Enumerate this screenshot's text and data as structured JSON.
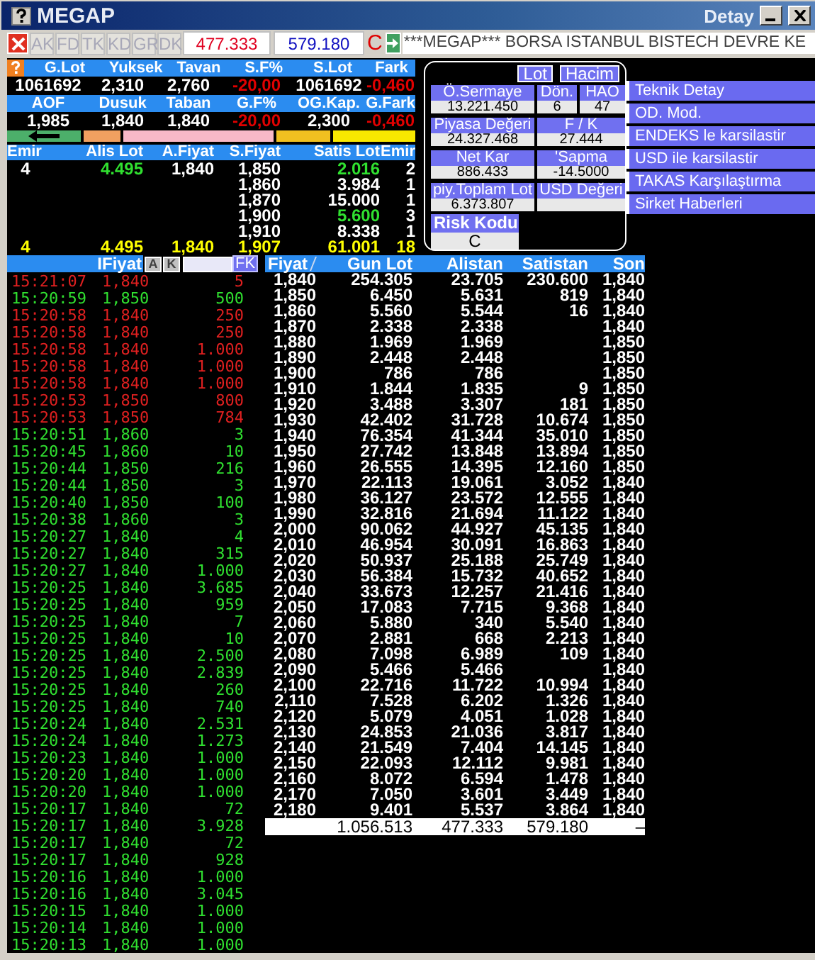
{
  "window": {
    "title": "MEGAP",
    "subtitle": "Detay"
  },
  "toolbar": {
    "buttons": [
      {
        "label": "AK"
      },
      {
        "label": "FD"
      },
      {
        "label": "TK"
      },
      {
        "label": "KD"
      },
      {
        "label": "GR"
      },
      {
        "label": "DK"
      }
    ],
    "buy_total": "477.333",
    "sell_total": "579.180",
    "risk_letter": "C",
    "ticker": "***MEGAP*** BORSA ISTANBUL BISTECH DEVRE KE"
  },
  "summary": [
    {
      "headers": [
        "G.Lot",
        "Yuksek",
        "Tavan",
        "S.F%",
        "S.Lot",
        "Fark"
      ],
      "values": [
        {
          "text": "1061692",
          "down": false
        },
        {
          "text": "2,310",
          "down": false
        },
        {
          "text": "2,760",
          "down": false
        },
        {
          "text": "-20,00",
          "down": true
        },
        {
          "text": "1061692",
          "down": false
        },
        {
          "text": "-0,460",
          "down": true
        }
      ]
    },
    {
      "headers": [
        "AOF",
        "Dusuk",
        "Taban",
        "G.F%",
        "OG.Kap.",
        "G.Fark"
      ],
      "values": [
        {
          "text": "1,985",
          "down": false
        },
        {
          "text": "1,840",
          "down": false
        },
        {
          "text": "1,840",
          "down": false
        },
        {
          "text": "-20,00",
          "down": true
        },
        {
          "text": "2,300",
          "down": false
        },
        {
          "text": "-0,460",
          "down": true
        }
      ]
    }
  ],
  "trend_bar": [
    {
      "color": "#4caf6a",
      "arrow": true
    },
    {
      "color": "#f0a060",
      "arrow": false
    },
    {
      "color": "#f8b8c8",
      "arrow": false
    },
    {
      "color": "#f0c020",
      "arrow": false
    },
    {
      "color": "#f8e800",
      "arrow": false
    }
  ],
  "depth": {
    "columns": [
      "Emir",
      "Alis Lot",
      "A.Fiyat",
      "S.Fiyat",
      "Satis Lot",
      "Emir"
    ],
    "rows": [
      {
        "kind": "level",
        "buy_orders": "4",
        "buy_lot": "4.495",
        "buy_lot_up": true,
        "buy_price": "1,840",
        "sell_price": "1,850",
        "sell_lot": "2.016",
        "sell_lot_up": true,
        "sell_orders": "2"
      },
      {
        "kind": "level",
        "sell_price": "1,860",
        "sell_lot": "3.984",
        "sell_lot_up": false,
        "sell_orders": "1"
      },
      {
        "kind": "level",
        "sell_price": "1,870",
        "sell_lot": "15.000",
        "sell_lot_up": false,
        "sell_orders": "1"
      },
      {
        "kind": "level",
        "sell_price": "1,900",
        "sell_lot": "5.600",
        "sell_lot_up": true,
        "sell_orders": "3"
      },
      {
        "kind": "level",
        "sell_price": "1,910",
        "sell_lot": "8.338",
        "sell_lot_up": false,
        "sell_orders": "1"
      },
      {
        "kind": "total",
        "buy_orders": "4",
        "buy_lot": "4.495",
        "buy_price": "1,840",
        "sell_price": "1,907",
        "sell_lot": "61.001",
        "sell_orders": "18"
      }
    ]
  },
  "info": {
    "tabs": [
      {
        "label": "Lot"
      },
      {
        "label": "Hacim"
      }
    ],
    "fields": [
      {
        "label": "Ö.Sermaye",
        "value": "13.221.450"
      },
      {
        "label": "Dön.",
        "value": "6"
      },
      {
        "label": "HAO",
        "value": "47"
      },
      {
        "label": "Piyasa Değeri",
        "value": "24.327.468"
      },
      {
        "label": "F / K",
        "value": "27.444"
      },
      {
        "label": "Net Kar",
        "value": "886.433"
      },
      {
        "label": "'Sapma",
        "value": "-14.5000"
      },
      {
        "label": "piy.Toplam Lot",
        "value": "6.373.807"
      },
      {
        "label": "USD Değeri"
      }
    ],
    "risk": {
      "label": "Risk Kodu",
      "value": "C"
    }
  },
  "links": [
    "Teknik Detay",
    "OD. Mod.",
    "ENDEKS le karsilastir",
    "USD ile karsilastir",
    "TAKAS Karşılaştırma",
    "Sirket Haberleri"
  ],
  "trades": {
    "header": "IFiyat",
    "buttons": [
      "A",
      "K"
    ],
    "filter_button": "FK",
    "rows": [
      {
        "time": "15:21:07",
        "price": "1,840",
        "lot": "5",
        "down": true
      },
      {
        "time": "15:20:59",
        "price": "1,850",
        "lot": "500",
        "down": false
      },
      {
        "time": "15:20:58",
        "price": "1,840",
        "lot": "250",
        "down": true
      },
      {
        "time": "15:20:58",
        "price": "1,840",
        "lot": "250",
        "down": true
      },
      {
        "time": "15:20:58",
        "price": "1,840",
        "lot": "1.000",
        "down": true
      },
      {
        "time": "15:20:58",
        "price": "1,840",
        "lot": "1.000",
        "down": true
      },
      {
        "time": "15:20:58",
        "price": "1,840",
        "lot": "1.000",
        "down": true
      },
      {
        "time": "15:20:53",
        "price": "1,850",
        "lot": "800",
        "down": true
      },
      {
        "time": "15:20:53",
        "price": "1,850",
        "lot": "784",
        "down": true
      },
      {
        "time": "15:20:51",
        "price": "1,860",
        "lot": "3",
        "down": false
      },
      {
        "time": "15:20:45",
        "price": "1,860",
        "lot": "10",
        "down": false
      },
      {
        "time": "15:20:44",
        "price": "1,850",
        "lot": "216",
        "down": false
      },
      {
        "time": "15:20:44",
        "price": "1,850",
        "lot": "3",
        "down": false
      },
      {
        "time": "15:20:40",
        "price": "1,850",
        "lot": "100",
        "down": false
      },
      {
        "time": "15:20:38",
        "price": "1,860",
        "lot": "3",
        "down": false
      },
      {
        "time": "15:20:27",
        "price": "1,840",
        "lot": "4",
        "down": false
      },
      {
        "time": "15:20:27",
        "price": "1,840",
        "lot": "315",
        "down": false
      },
      {
        "time": "15:20:27",
        "price": "1,840",
        "lot": "1.000",
        "down": false
      },
      {
        "time": "15:20:25",
        "price": "1,840",
        "lot": "3.685",
        "down": false
      },
      {
        "time": "15:20:25",
        "price": "1,840",
        "lot": "959",
        "down": false
      },
      {
        "time": "15:20:25",
        "price": "1,840",
        "lot": "7",
        "down": false
      },
      {
        "time": "15:20:25",
        "price": "1,840",
        "lot": "10",
        "down": false
      },
      {
        "time": "15:20:25",
        "price": "1,840",
        "lot": "2.500",
        "down": false
      },
      {
        "time": "15:20:25",
        "price": "1,840",
        "lot": "2.839",
        "down": false
      },
      {
        "time": "15:20:25",
        "price": "1,840",
        "lot": "260",
        "down": false
      },
      {
        "time": "15:20:25",
        "price": "1,840",
        "lot": "740",
        "down": false
      },
      {
        "time": "15:20:24",
        "price": "1,840",
        "lot": "2.531",
        "down": false
      },
      {
        "time": "15:20:24",
        "price": "1,840",
        "lot": "1.273",
        "down": false
      },
      {
        "time": "15:20:23",
        "price": "1,840",
        "lot": "1.000",
        "down": false
      },
      {
        "time": "15:20:20",
        "price": "1,840",
        "lot": "1.000",
        "down": false
      },
      {
        "time": "15:20:20",
        "price": "1,840",
        "lot": "1.000",
        "down": false
      },
      {
        "time": "15:20:17",
        "price": "1,840",
        "lot": "72",
        "down": false
      },
      {
        "time": "15:20:17",
        "price": "1,840",
        "lot": "3.928",
        "down": false
      },
      {
        "time": "15:20:17",
        "price": "1,840",
        "lot": "72",
        "down": false
      },
      {
        "time": "15:20:17",
        "price": "1,840",
        "lot": "928",
        "down": false
      },
      {
        "time": "15:20:16",
        "price": "1,840",
        "lot": "1.000",
        "down": false
      },
      {
        "time": "15:20:16",
        "price": "1,840",
        "lot": "3.045",
        "down": false
      },
      {
        "time": "15:20:15",
        "price": "1,840",
        "lot": "1.000",
        "down": false
      },
      {
        "time": "15:20:14",
        "price": "1,840",
        "lot": "1.000",
        "down": false
      },
      {
        "time": "15:20:13",
        "price": "1,840",
        "lot": "1.000",
        "down": false
      }
    ]
  },
  "price_table": {
    "columns": [
      "Fiyat",
      "Gun Lot",
      "Alistan",
      "Satistan",
      "Son"
    ],
    "rows": [
      {
        "price": "1,840",
        "day_lot": "254.305",
        "bought": "23.705",
        "sold": "230.600",
        "last": "1,840"
      },
      {
        "price": "1,850",
        "day_lot": "6.450",
        "bought": "5.631",
        "sold": "819",
        "last": "1,840"
      },
      {
        "price": "1,860",
        "day_lot": "5.560",
        "bought": "5.544",
        "sold": "16",
        "last": "1,840"
      },
      {
        "price": "1,870",
        "day_lot": "2.338",
        "bought": "2.338",
        "last": "1,840"
      },
      {
        "price": "1,880",
        "day_lot": "1.969",
        "bought": "1.969",
        "last": "1,850"
      },
      {
        "price": "1,890",
        "day_lot": "2.448",
        "bought": "2.448",
        "last": "1,850"
      },
      {
        "price": "1,900",
        "day_lot": "786",
        "bought": "786",
        "last": "1,850"
      },
      {
        "price": "1,910",
        "day_lot": "1.844",
        "bought": "1.835",
        "sold": "9",
        "last": "1,850"
      },
      {
        "price": "1,920",
        "day_lot": "3.488",
        "bought": "3.307",
        "sold": "181",
        "last": "1,850"
      },
      {
        "price": "1,930",
        "day_lot": "42.402",
        "bought": "31.728",
        "sold": "10.674",
        "last": "1,850"
      },
      {
        "price": "1,940",
        "day_lot": "76.354",
        "bought": "41.344",
        "sold": "35.010",
        "last": "1,850"
      },
      {
        "price": "1,950",
        "day_lot": "27.742",
        "bought": "13.848",
        "sold": "13.894",
        "last": "1,850"
      },
      {
        "price": "1,960",
        "day_lot": "26.555",
        "bought": "14.395",
        "sold": "12.160",
        "last": "1,850"
      },
      {
        "price": "1,970",
        "day_lot": "22.113",
        "bought": "19.061",
        "sold": "3.052",
        "last": "1,840"
      },
      {
        "price": "1,980",
        "day_lot": "36.127",
        "bought": "23.572",
        "sold": "12.555",
        "last": "1,840"
      },
      {
        "price": "1,990",
        "day_lot": "32.816",
        "bought": "21.694",
        "sold": "11.122",
        "last": "1,840"
      },
      {
        "price": "2,000",
        "day_lot": "90.062",
        "bought": "44.927",
        "sold": "45.135",
        "last": "1,840"
      },
      {
        "price": "2,010",
        "day_lot": "46.954",
        "bought": "30.091",
        "sold": "16.863",
        "last": "1,840"
      },
      {
        "price": "2,020",
        "day_lot": "50.937",
        "bought": "25.188",
        "sold": "25.749",
        "last": "1,840"
      },
      {
        "price": "2,030",
        "day_lot": "56.384",
        "bought": "15.732",
        "sold": "40.652",
        "last": "1,840"
      },
      {
        "price": "2,040",
        "day_lot": "33.673",
        "bought": "12.257",
        "sold": "21.416",
        "last": "1,840"
      },
      {
        "price": "2,050",
        "day_lot": "17.083",
        "bought": "7.715",
        "sold": "9.368",
        "last": "1,840"
      },
      {
        "price": "2,060",
        "day_lot": "5.880",
        "bought": "340",
        "sold": "5.540",
        "last": "1,840"
      },
      {
        "price": "2,070",
        "day_lot": "2.881",
        "bought": "668",
        "sold": "2.213",
        "last": "1,840"
      },
      {
        "price": "2,080",
        "day_lot": "7.098",
        "bought": "6.989",
        "sold": "109",
        "last": "1,840"
      },
      {
        "price": "2,090",
        "day_lot": "5.466",
        "bought": "5.466",
        "last": "1,840"
      },
      {
        "price": "2,100",
        "day_lot": "22.716",
        "bought": "11.722",
        "sold": "10.994",
        "last": "1,840"
      },
      {
        "price": "2,110",
        "day_lot": "7.528",
        "bought": "6.202",
        "sold": "1.326",
        "last": "1,840"
      },
      {
        "price": "2,120",
        "day_lot": "5.079",
        "bought": "4.051",
        "sold": "1.028",
        "last": "1,840"
      },
      {
        "price": "2,130",
        "day_lot": "24.853",
        "bought": "21.036",
        "sold": "3.817",
        "last": "1,840"
      },
      {
        "price": "2,140",
        "day_lot": "21.549",
        "bought": "7.404",
        "sold": "14.145",
        "last": "1,840"
      },
      {
        "price": "2,150",
        "day_lot": "22.093",
        "bought": "12.112",
        "sold": "9.981",
        "last": "1,840"
      },
      {
        "price": "2,160",
        "day_lot": "8.072",
        "bought": "6.594",
        "sold": "1.478",
        "last": "1,840"
      },
      {
        "price": "2,170",
        "day_lot": "7.050",
        "bought": "3.601",
        "sold": "3.449",
        "last": "1,840"
      },
      {
        "price": "2,180",
        "day_lot": "9.401",
        "bought": "5.537",
        "sold": "3.864",
        "last": "1,840"
      }
    ],
    "totals": {
      "day_lot": "1.056.513",
      "bought": "477.333",
      "sold": "579.180",
      "last": "–"
    }
  }
}
